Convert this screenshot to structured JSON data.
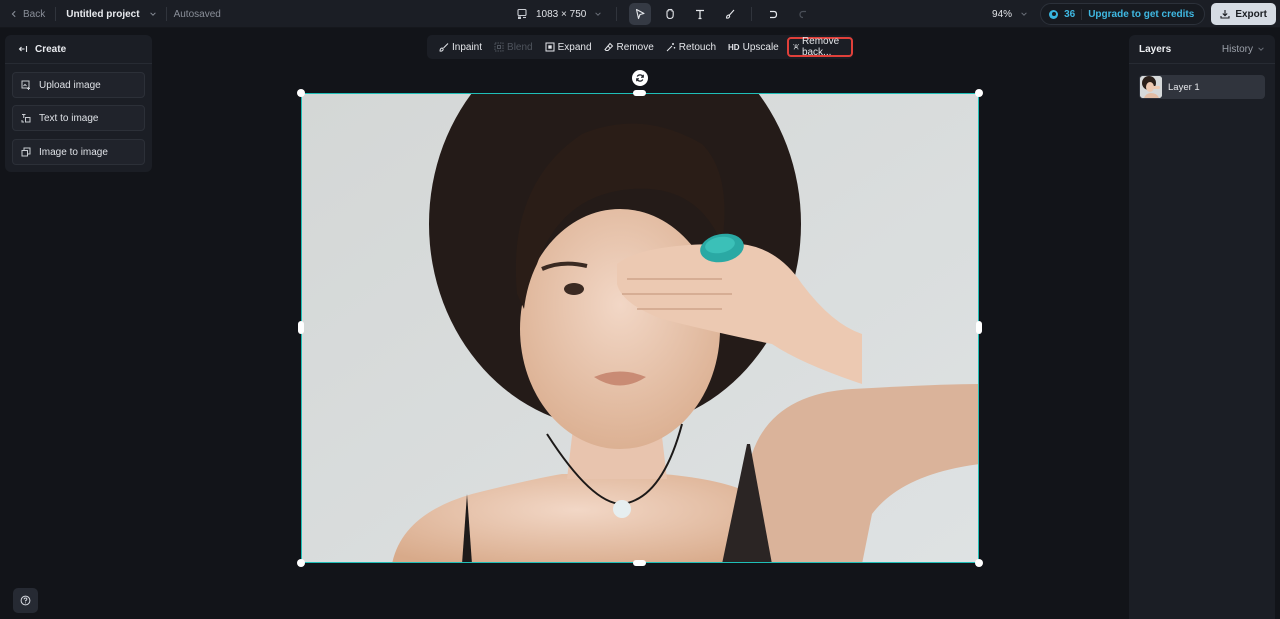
{
  "topbar": {
    "back_label": "Back",
    "project_name": "Untitled project",
    "save_status": "Autosaved",
    "canvas_size": "1083 × 750",
    "tools": [
      {
        "name": "select",
        "icon": "cursor-icon",
        "active": true
      },
      {
        "name": "hand",
        "icon": "hand-icon",
        "active": false
      },
      {
        "name": "text",
        "icon": "text-icon",
        "active": false
      },
      {
        "name": "brush",
        "icon": "brush-icon",
        "active": false
      }
    ],
    "zoom_level": "94%",
    "credits": "36",
    "upgrade_label": "Upgrade to get credits",
    "export_label": "Export"
  },
  "left_panel": {
    "title": "Create",
    "buttons": [
      {
        "label": "Upload image",
        "icon": "upload-image-icon"
      },
      {
        "label": "Text to image",
        "icon": "text-to-image-icon"
      },
      {
        "label": "Image to image",
        "icon": "image-to-image-icon"
      }
    ]
  },
  "floating_toolbar": {
    "items": [
      {
        "label": "Inpaint",
        "icon": "inpaint-icon",
        "enabled": true
      },
      {
        "label": "Blend",
        "icon": "blend-icon",
        "enabled": false
      },
      {
        "label": "Expand",
        "icon": "expand-icon",
        "enabled": true
      },
      {
        "label": "Remove",
        "icon": "eraser-icon",
        "enabled": true
      },
      {
        "label": "Retouch",
        "icon": "magic-wand-icon",
        "enabled": true
      },
      {
        "label": "Upscale",
        "icon_text": "HD",
        "enabled": true
      },
      {
        "label": "Remove back...",
        "icon": "remove-background-icon",
        "enabled": true,
        "highlighted": true
      }
    ]
  },
  "right_panel": {
    "title": "Layers",
    "history_label": "History",
    "layers": [
      {
        "label": "Layer 1",
        "selected": true
      }
    ]
  },
  "canvas": {
    "image_description": "Portrait of a woman with short dark hair, black hat behind head, hand with turquoise ring covering one eye, black choker with white pendant, light gray background"
  },
  "colors": {
    "accent": "#1fbfb8",
    "credits": "#3fb8e2",
    "highlight_border": "#e0403a",
    "background": "#121419",
    "panel": "#1b1e25"
  }
}
